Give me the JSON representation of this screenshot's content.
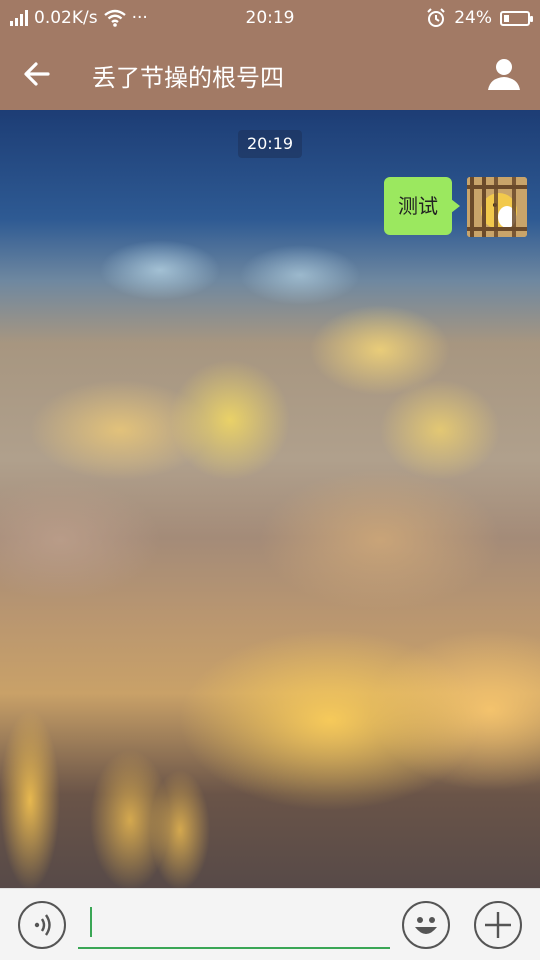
{
  "status_bar": {
    "net_speed": "0.02K/s",
    "more_dots": "···",
    "time": "20:19",
    "battery_percent": "24%",
    "battery_level": 0.24
  },
  "header": {
    "title": "丢了节操的根号四",
    "back_icon": "arrow-left-icon",
    "profile_icon": "person-icon"
  },
  "chat": {
    "timestamp": "20:19",
    "messages": [
      {
        "text": "测试",
        "from": "self"
      }
    ]
  },
  "input_bar": {
    "voice_icon": "voice-icon",
    "emoji_icon": "emoji-icon",
    "plus_icon": "plus-icon",
    "accent_color": "#3aa655"
  },
  "colors": {
    "header_bg": "#a27a65",
    "bubble_bg": "#9be85f"
  }
}
